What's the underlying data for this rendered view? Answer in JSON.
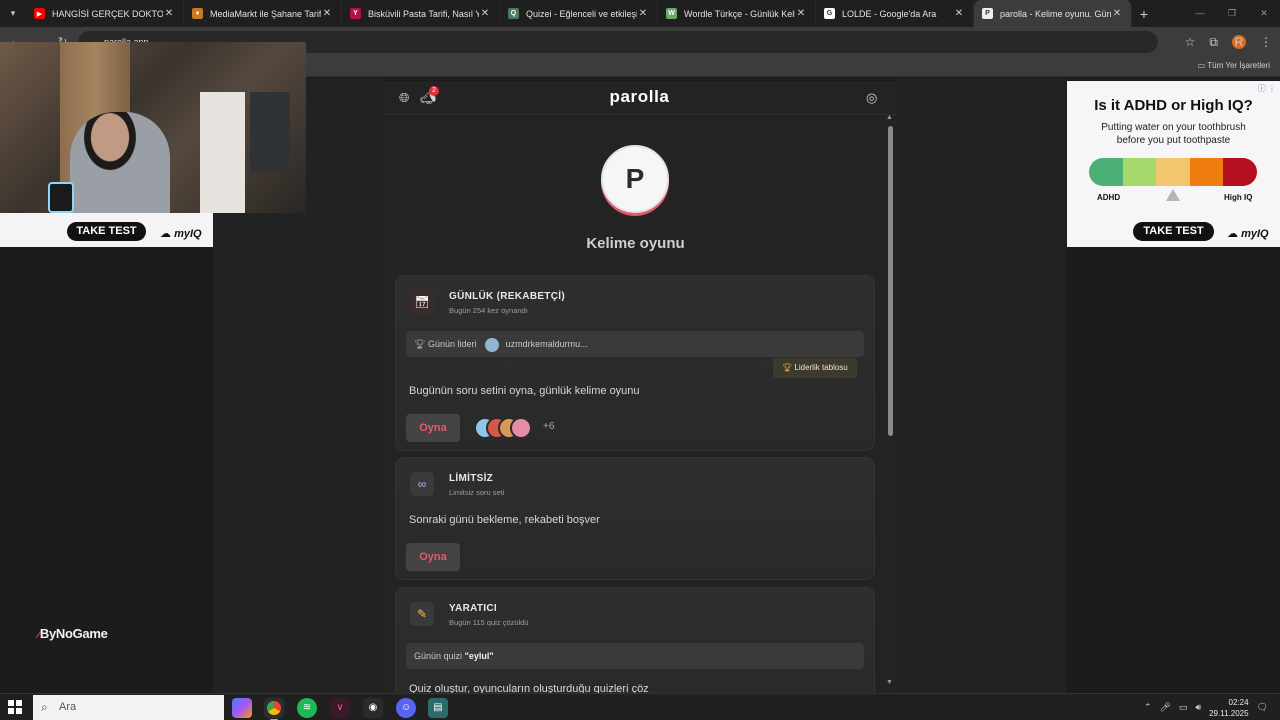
{
  "browser": {
    "tabs": [
      {
        "title": "HANGİSİ GERÇEK DOKTOR?! ft.",
        "favicon_color": "#ff0000",
        "favicon_glyph": "▶",
        "active": false
      },
      {
        "title": "MediaMarkt ile Şahane Tarifler",
        "favicon_color": "#c87a1d",
        "favicon_glyph": "♦",
        "active": false
      },
      {
        "title": "Bisküvili Pasta Tarifi, Nasıl Yapılı",
        "favicon_color": "#b0134a",
        "favicon_glyph": "Y",
        "active": false
      },
      {
        "title": "Quizei - Eğlenceli ve etkileşimli",
        "favicon_color": "#4a7b5a",
        "favicon_glyph": "Q",
        "active": false
      },
      {
        "title": "Wordle Türkçe - Günlük Kelime",
        "favicon_color": "#6aaa64",
        "favicon_glyph": "W",
        "active": false
      },
      {
        "title": "LOLDE - Google'da Ara",
        "favicon_color": "#ffffff",
        "favicon_glyph": "G",
        "active": false
      },
      {
        "title": "parolla - Kelime oyunu. Günlük",
        "favicon_color": "#eeeeee",
        "favicon_glyph": "P",
        "active": true
      }
    ],
    "new_tab_label": "+",
    "close_glyph": "✕",
    "address": "parolla.app",
    "bookmarks_label": "Tüm Yer İşaretleri",
    "profile_letter": "R"
  },
  "overlay": {
    "ad_left_button": "TAKE TEST",
    "ad_left_brand": "myIQ",
    "streamer_logo": "ByNoGame"
  },
  "ad_right": {
    "title": "Is it ADHD or High IQ?",
    "subtitle": "Putting water on your toothbrush before you put toothpaste",
    "left_label": "ADHD",
    "right_label": "High IQ",
    "button": "TAKE TEST",
    "brand": "myIQ",
    "scale_colors": [
      "#4caf78",
      "#a5d86a",
      "#f2c66f",
      "#ef7d10",
      "#b5101f"
    ]
  },
  "game": {
    "brand": "parolla",
    "notification_count": "2",
    "avatar_letter": "P",
    "subtitle": "Kelime oyunu",
    "cards": {
      "daily": {
        "title": "GÜNLÜK (REKABETÇİ)",
        "sub": "Bugün 254 kez oynandı",
        "leader_label": "Günün lideri",
        "leader_name": "uzmdrkemaldurmu...",
        "leaderboard_button": "Liderlik tablosu",
        "description": "Bugünün soru setini oyna, günlük kelime oyunu",
        "play": "Oyna",
        "more_players": "+6"
      },
      "unlimited": {
        "title": "LİMİTSİZ",
        "sub": "Limitsiz soru seti",
        "description": "Sonraki günü bekleme, rekabeti boşver",
        "play": "Oyna"
      },
      "creator": {
        "title": "YARATICI",
        "sub": "Bugün 115 quiz çözüldü",
        "quiz_label": "Günün quizi",
        "quiz_name": "\"eylul\"",
        "description": "Quiz oluştur, oyuncuların oluşturduğu quizleri çöz"
      }
    }
  },
  "taskbar": {
    "search_placeholder": "Ara",
    "time": "02:24",
    "date": "29.11.2025"
  }
}
